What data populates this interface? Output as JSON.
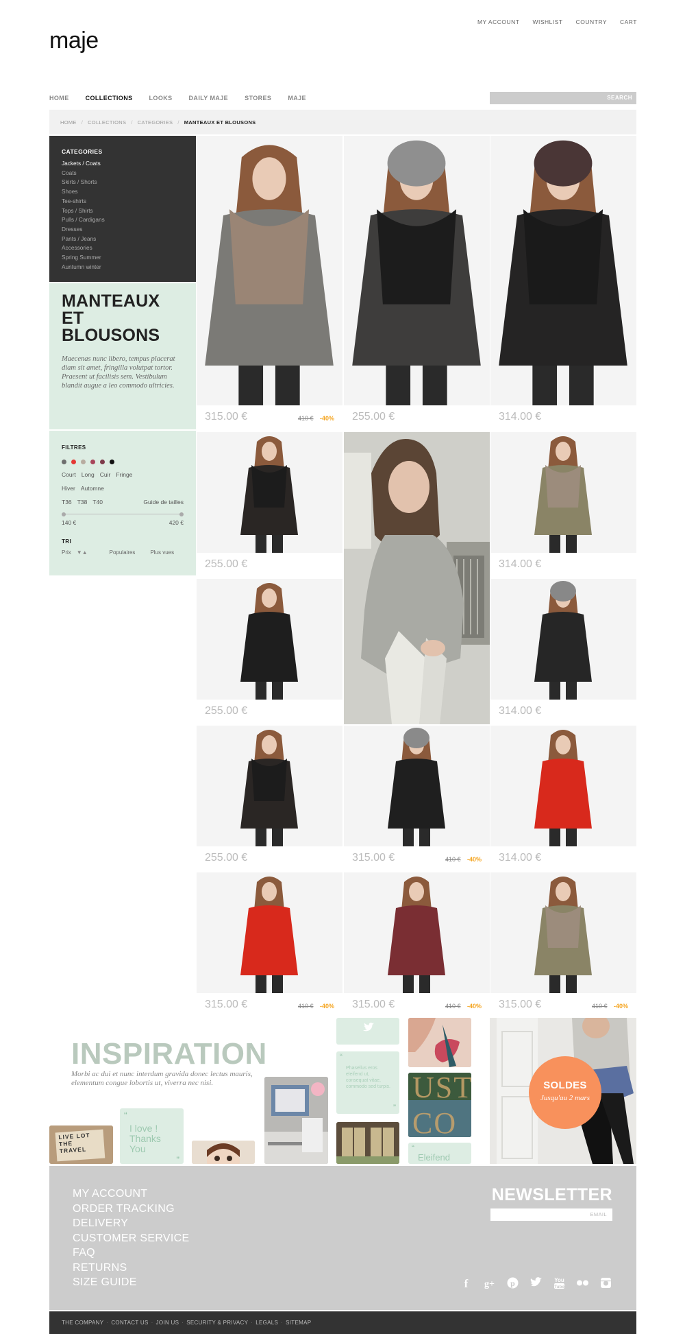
{
  "util_nav": [
    "MY ACCOUNT",
    "WISHLIST",
    "COUNTRY",
    "CART"
  ],
  "logo": "maje",
  "main_nav": [
    "HOME",
    "COLLECTIONS",
    "LOOKS",
    "DAILY MAJE",
    "STORES",
    "MAJE"
  ],
  "search": {
    "button": "SEARCH"
  },
  "breadcrumb": [
    "HOME",
    "COLLECTIONS",
    "CATEGORIES",
    "MANTEAUX ET BLOUSONS"
  ],
  "sidebar": {
    "categories_title": "CATEGORIES",
    "categories": [
      "Jackets / Coats",
      "Coats",
      "Skirts / Shorts",
      "Shoes",
      "Tee-shirts",
      "Tops / Shirts",
      "Pulls / Cardigans",
      "Dresses",
      "Pants / Jeans",
      "Accessories",
      "Spring Summer",
      "Auntumn winter"
    ],
    "page_title": "MANTEAUX ET BLOUSONS",
    "page_text": "Maecenas nunc libero, tempus placerat diam sit amet, fringilla volutpat tortor. Praesent ut facilisis sem. Vestibulum blandit augue a leo commodo ultricies.",
    "filters_title": "FILTRES",
    "colors": [
      "#6e6e6e",
      "#e53935",
      "#b8aca0",
      "#a8455a",
      "#7d3a4a",
      "#111111"
    ],
    "lengths": [
      "Court",
      "Long",
      "Cuir",
      "Fringe"
    ],
    "seasons": [
      "Hiver",
      "Automne"
    ],
    "sizes": [
      "T36",
      "T38",
      "T40"
    ],
    "size_guide": "Guide de tailles",
    "price_min": "140 €",
    "price_max": "420 €",
    "sort_title": "TRI",
    "sort_price": "Prix",
    "sort_arrows": "▼▲",
    "sort_popular": "Populaires",
    "sort_views": "Plus vues"
  },
  "products": [
    {
      "price": "315.00 €",
      "old": "410 €",
      "discount": "-40%",
      "coat": "#7b7a76",
      "fur": "#9a8575",
      "hat": "none"
    },
    {
      "price": "255.00 €",
      "old": "",
      "discount": "",
      "coat": "#3e3d3c",
      "fur": "#1c1c1c",
      "hat": "#8f8f8f"
    },
    {
      "price": "314.00 €",
      "old": "",
      "discount": "",
      "coat": "#252424",
      "fur": "#1a1a1a",
      "hat": "#4a3636"
    },
    {
      "price": "255.00 €",
      "old": "",
      "discount": "",
      "coat": "#2a2624",
      "fur": "#1c1c1c",
      "hat": "none"
    },
    {
      "price": "314.00 €",
      "old": "",
      "discount": "",
      "coat": "#8a8466",
      "fur": "#9c8c7c",
      "hat": "none"
    },
    {
      "price": "255.00 €",
      "old": "",
      "discount": "",
      "coat": "#1e1e1e",
      "fur": "none",
      "hat": "none"
    },
    {
      "price": "314.00 €",
      "old": "",
      "discount": "",
      "coat": "#262626",
      "fur": "none",
      "hat": "#888888"
    },
    {
      "price": "255.00 €",
      "old": "",
      "discount": "",
      "coat": "#2a2624",
      "fur": "#1c1c1c",
      "hat": "none"
    },
    {
      "price": "315.00 €",
      "old": "410 €",
      "discount": "-40%",
      "coat": "#1f1f1f",
      "fur": "none",
      "hat": "#8a8a8a"
    },
    {
      "price": "314.00 €",
      "old": "",
      "discount": "",
      "coat": "#d8291c",
      "fur": "none",
      "hat": "none"
    },
    {
      "price": "315.00 €",
      "old": "410 €",
      "discount": "-40%",
      "coat": "#d8291c",
      "fur": "none",
      "hat": "none"
    },
    {
      "price": "315.00 €",
      "old": "410 €",
      "discount": "-40%",
      "coat": "#7a2e33",
      "fur": "none",
      "hat": "none"
    },
    {
      "price": "315.00 €",
      "old": "410 €",
      "discount": "-40%",
      "coat": "#8a8466",
      "fur": "#9c8c7c",
      "hat": "none"
    }
  ],
  "inspiration": {
    "title": "INSPIRATION",
    "text": "Morbi ac dui et nunc interdum gravida donec lectus mauris, elementum congue lobortis ut, viverra nec nisi.",
    "quote1": "I love ! Thanks You",
    "quote2": "Phasellus eros eleifend ut, consequat vitae, commodo sed turpis.",
    "quote3": "Eleifend",
    "poster_text": "LIVE LOT THE TRAVEL",
    "sign_text": "UST CO",
    "soldes_title": "SOLDES",
    "soldes_sub": "Jusqu'au 2 mars"
  },
  "footer": {
    "links": [
      "MY ACCOUNT",
      "ORDER TRACKING",
      "DELIVERY",
      "CUSTOMER SERVICE",
      "FAQ",
      "RETURNS",
      "SIZE GUIDE"
    ],
    "newsletter_title": "NEWSLETTER",
    "newsletter_placeholder": "EMAIL",
    "social": [
      "facebook-icon",
      "google-plus-icon",
      "pinterest-icon",
      "twitter-icon",
      "youtube-icon",
      "flickr-icon",
      "instagram-icon"
    ],
    "bottom_links": [
      "THE COMPANY",
      "CONTACT US",
      "JOIN US",
      "SECURITY & PRIVACY",
      "LEGALS",
      "SITEMAP"
    ]
  }
}
